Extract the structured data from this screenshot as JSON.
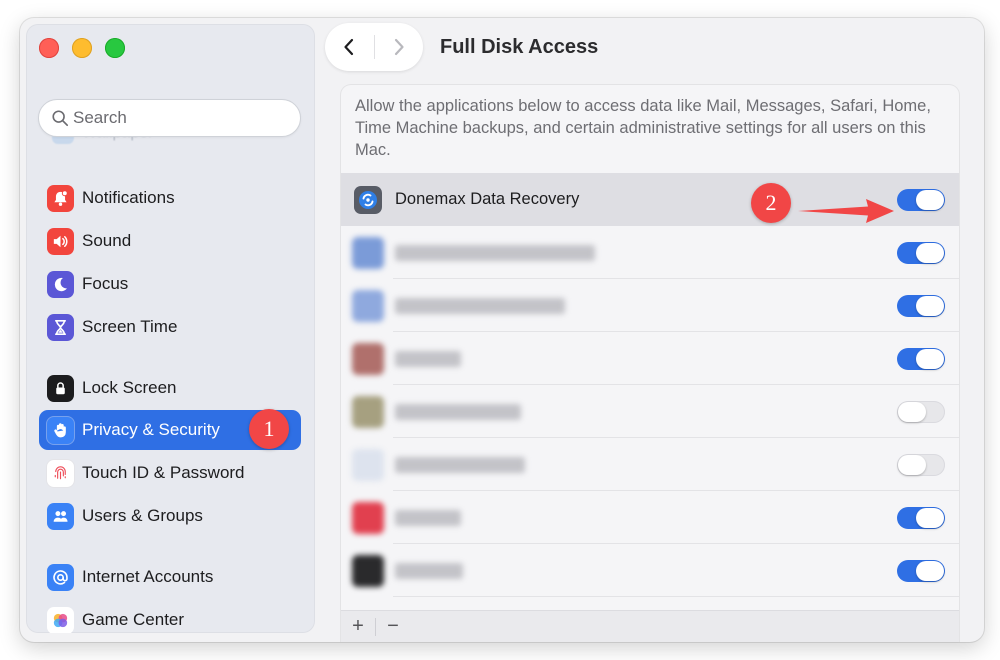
{
  "window": {
    "title": "Full Disk Access"
  },
  "sidebar": {
    "search_placeholder": "Search",
    "hidden_prev_label": "Wallpaper",
    "items": [
      {
        "label": "Notifications",
        "icon": "bell-icon",
        "color": "#f2453d"
      },
      {
        "label": "Sound",
        "icon": "speaker-icon",
        "color": "#f2453d"
      },
      {
        "label": "Focus",
        "icon": "moon-icon",
        "color": "#5b57d6"
      },
      {
        "label": "Screen Time",
        "icon": "hourglass-icon",
        "color": "#5b57d6"
      },
      {
        "label": "Lock Screen",
        "icon": "lock-icon",
        "color": "#1c1c1e"
      },
      {
        "label": "Privacy & Security",
        "icon": "hand-icon",
        "color": "#3a82f6",
        "selected": true
      },
      {
        "label": "Touch ID & Password",
        "icon": "fingerprint-icon",
        "color": "#ffffff"
      },
      {
        "label": "Users & Groups",
        "icon": "users-icon",
        "color": "#3a82f6"
      },
      {
        "label": "Internet Accounts",
        "icon": "at-icon",
        "color": "#3a82f6"
      },
      {
        "label": "Game Center",
        "icon": "game-center-icon",
        "color": "#ffffff"
      }
    ]
  },
  "annotations": {
    "step1": "1",
    "step2": "2"
  },
  "main": {
    "description": "Allow the applications below to access data like Mail, Messages, Safari, Home, Time Machine backups, and certain administrative settings for all users on this Mac.",
    "apps": [
      {
        "name": "Donemax Data Recovery",
        "enabled": true,
        "highlighted": true
      },
      {
        "name": "",
        "enabled": true,
        "blurred": true,
        "icon_color": "#7b9bd8"
      },
      {
        "name": "",
        "enabled": true,
        "blurred": true,
        "icon_color": "#8fa9de"
      },
      {
        "name": "",
        "enabled": true,
        "blurred": true,
        "icon_color": "#b0706c"
      },
      {
        "name": "",
        "enabled": false,
        "blurred": true,
        "icon_color": "#a6a080"
      },
      {
        "name": "",
        "enabled": false,
        "blurred": true,
        "icon_color": "#dde3ee"
      },
      {
        "name": "",
        "enabled": true,
        "blurred": true,
        "icon_color": "#e1404f"
      },
      {
        "name": "",
        "enabled": true,
        "blurred": true,
        "icon_color": "#2a2a2c"
      }
    ],
    "footer": {
      "add": "+",
      "remove": "−"
    }
  },
  "colors": {
    "accent": "#2f6fe4",
    "annotation": "#f14646"
  }
}
